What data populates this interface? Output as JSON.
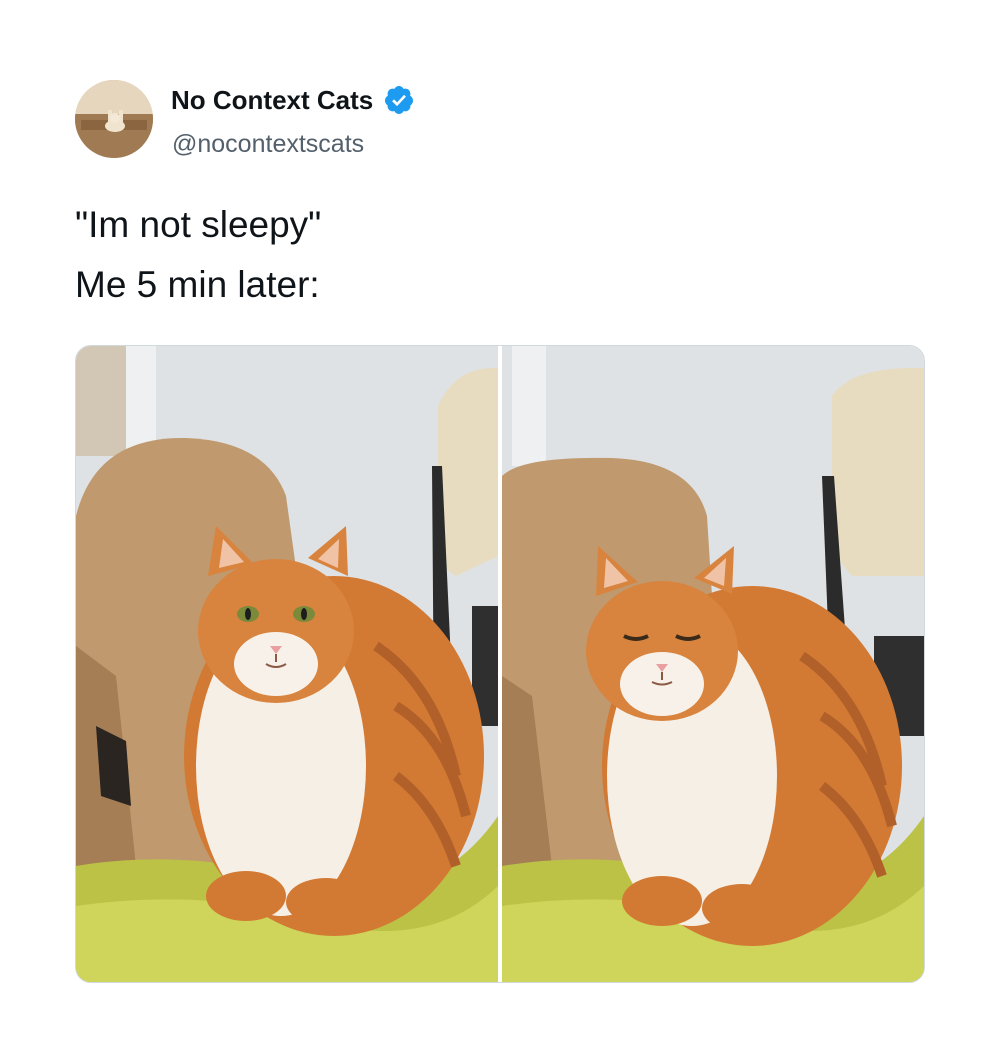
{
  "author": {
    "display_name": "No Context Cats",
    "handle": "@nocontextscats",
    "verified": true,
    "avatar_icon": "cat-avatar"
  },
  "tweet": {
    "lines": [
      "\"Im not sleepy\"",
      "Me 5 min later:"
    ]
  },
  "media": {
    "photos": [
      {
        "icon": "orange-cat-awake-photo",
        "eyes": "open"
      },
      {
        "icon": "orange-cat-sleepy-photo",
        "eyes": "closed"
      }
    ]
  },
  "colors": {
    "verified_blue": "#1d9bf0",
    "handle_gray": "#53606b",
    "text": "#0f1419"
  }
}
